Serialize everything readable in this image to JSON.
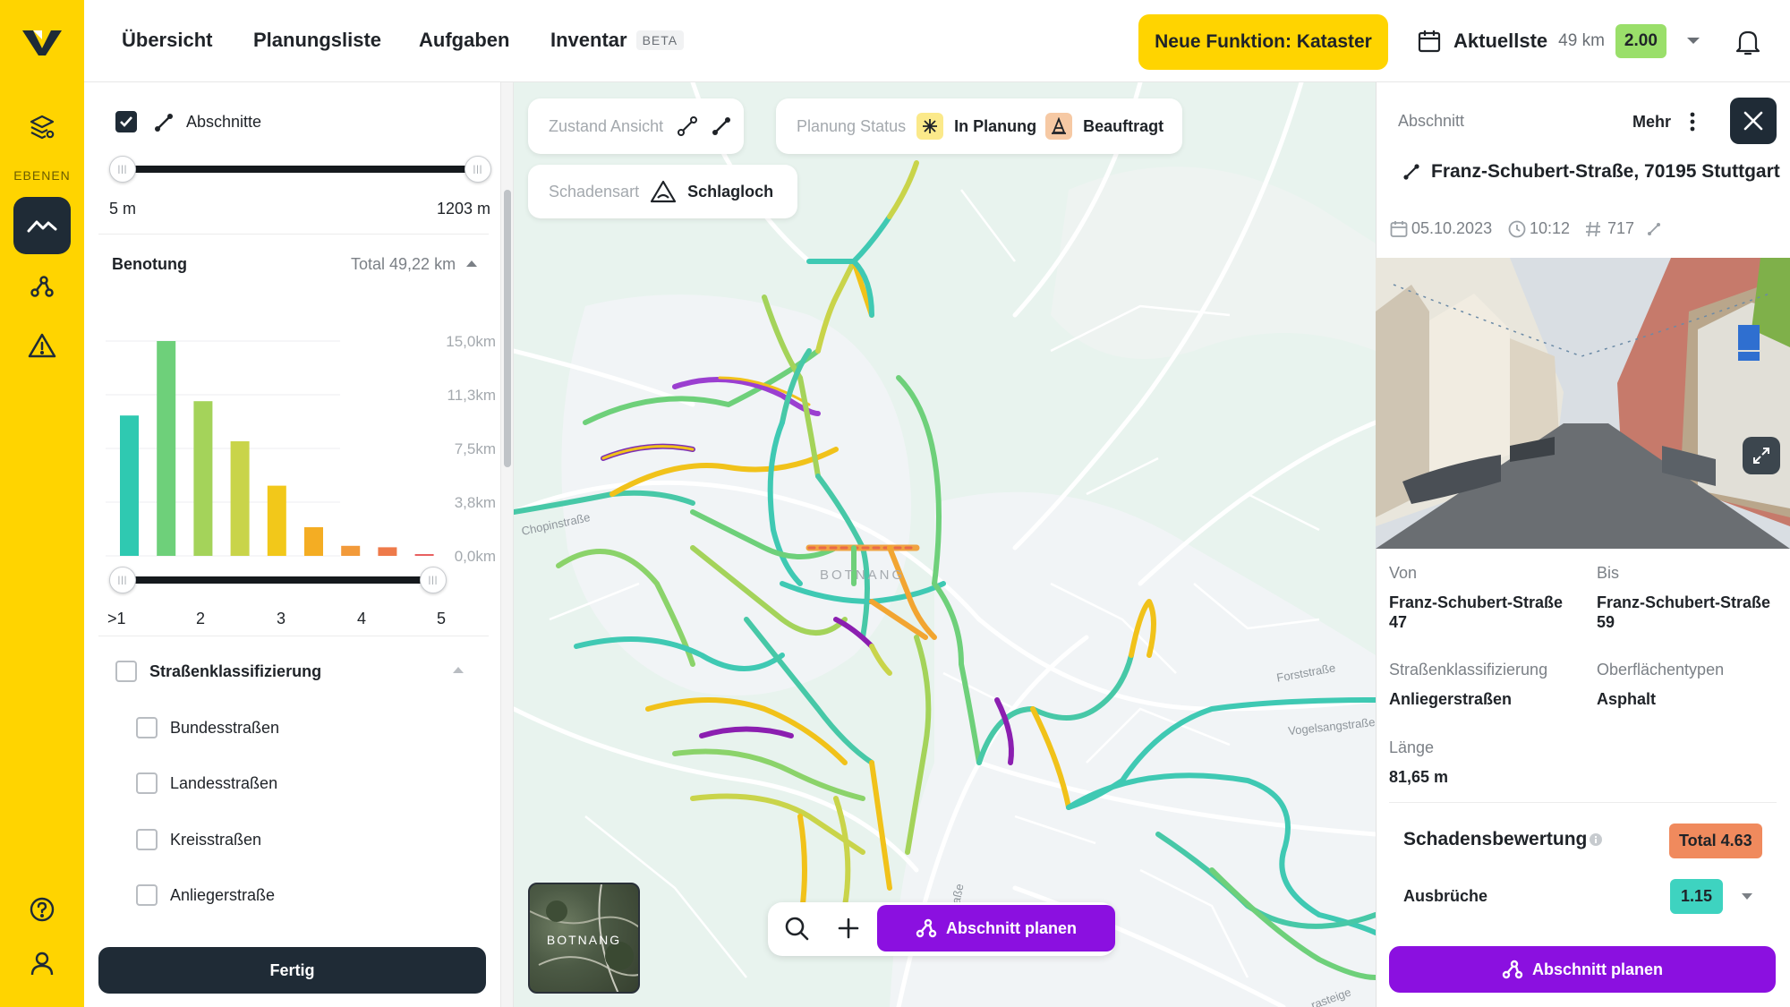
{
  "colors": {
    "brand_yellow": "#FFD400",
    "dark": "#1f2b36",
    "purple": "#8b10e0",
    "score_green": "#9adf6a",
    "teal": "#3ed3c0",
    "orange": "#f08a5d"
  },
  "rail": {
    "layers_label": "EBENEN",
    "icons": [
      "logo-icon",
      "layers-settings-icon",
      "trend-line-icon",
      "route-plan-icon",
      "warning-icon",
      "help-icon",
      "user-icon"
    ]
  },
  "topbar": {
    "nav": [
      "Übersicht",
      "Planungsliste",
      "Aufgaben",
      "Inventar"
    ],
    "beta_badge": "BETA",
    "new_feature_button": "Neue Funktion: Kataster",
    "list_title": "Aktuellste",
    "list_km": "49 km",
    "list_score": "2.00"
  },
  "left_panel": {
    "abschnitte_label": "Abschnitte",
    "abschnitte_checked": true,
    "length_min": "5 m",
    "length_max": "1203 m",
    "benotung_label": "Benotung",
    "benotung_total": "Total 49,22 km",
    "grade_ticks": [
      ">1",
      "2",
      "3",
      "4",
      "5"
    ],
    "strassen_label": "Straßenklassifizierung",
    "strassen_items": [
      "Bundesstraßen",
      "Landesstraßen",
      "Kreisstraßen",
      "Anliegerstraße"
    ],
    "done_button": "Fertig"
  },
  "chart_data": {
    "type": "bar",
    "title": "Benotung",
    "ylabel": "",
    "yticks": [
      "15,0km",
      "11,3km",
      "7,5km",
      "3,8km",
      "0,0km"
    ],
    "ylim": [
      0,
      15.0
    ],
    "values": [
      9.8,
      15.0,
      10.8,
      8.0,
      4.9,
      2.0,
      0.7,
      0.6,
      0.1
    ],
    "bar_colors": [
      "#2fc9b1",
      "#6ed07a",
      "#a4d35a",
      "#c9d44a",
      "#f2c81a",
      "#f4ad23",
      "#f29a3a",
      "#ee7a4a",
      "#e86060"
    ],
    "grid": true
  },
  "map": {
    "zustand_label": "Zustand Ansicht",
    "planung_label": "Planung Status",
    "in_planung": "In Planung",
    "beauftragt": "Beauftragt",
    "schadensart_label": "Schadensart",
    "schlagloch": "Schlagloch",
    "district": "BOTNANG",
    "street_labels": [
      "Chopinstraße",
      "Forststraße",
      "Vogelsangstraße",
      "straße",
      "rasteige"
    ],
    "minimap_label": "BOTNANG",
    "plan_button": "Abschnitt planen"
  },
  "right_panel": {
    "header": "Abschnitt",
    "more": "Mehr",
    "address": "Franz-Schubert-Straße, 70195 Stuttgart",
    "date": "05.10.2023",
    "time": "10:12",
    "id": "717",
    "von_label": "Von",
    "von_value": "Franz-Schubert-Straße 47",
    "bis_label": "Bis",
    "bis_value": "Franz-Schubert-Straße 59",
    "klass_label": "Straßenklassifizierung",
    "klass_value": "Anliegerstraßen",
    "oberflaeche_label": "Oberflächentypen",
    "oberflaeche_value": "Asphalt",
    "laenge_label": "Länge",
    "laenge_value": "81,65 m",
    "bewertung_label": "Schadensbewertung",
    "bewertung_total": "Total 4.63",
    "ausbrueche_label": "Ausbrüche",
    "ausbrueche_value": "1.15",
    "plan_button": "Abschnitt planen"
  }
}
